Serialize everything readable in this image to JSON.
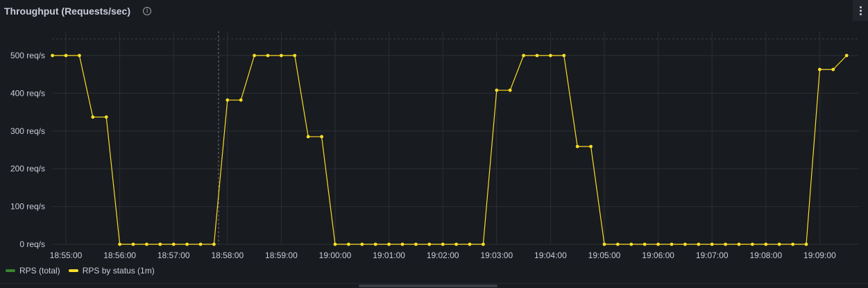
{
  "panel": {
    "title": "Throughput (Requests/sec)",
    "info_icon": "info-icon",
    "menu_icon": "kebab-menu-icon"
  },
  "chart_data": {
    "type": "line",
    "title": "Throughput (Requests/sec)",
    "xlabel": "",
    "ylabel": "",
    "ylim": [
      0,
      500
    ],
    "yticks": [
      "0 req/s",
      "100 req/s",
      "200 req/s",
      "300 req/s",
      "400 req/s",
      "500 req/s"
    ],
    "xticks": [
      "18:55:00",
      "18:56:00",
      "18:57:00",
      "18:58:00",
      "18:59:00",
      "19:00:00",
      "19:01:00",
      "19:02:00",
      "19:03:00",
      "19:04:00",
      "19:05:00",
      "19:06:00",
      "19:07:00",
      "19:08:00",
      "19:09:00"
    ],
    "grid": true,
    "legend_position": "bottom-left",
    "colors": {
      "rps_total": "#37872d",
      "rps_status": "#fade2a",
      "grid": "#2c2f35",
      "axis_text": "#ccccdc"
    },
    "series": [
      {
        "name": "RPS (total)",
        "values": []
      },
      {
        "name": "RPS by status (1m)",
        "x": [
          "18:54:45",
          "18:55:00",
          "18:55:15",
          "18:55:30",
          "18:55:45",
          "18:56:00",
          "18:56:15",
          "18:56:30",
          "18:56:45",
          "18:57:00",
          "18:57:15",
          "18:57:30",
          "18:57:45",
          "18:58:00",
          "18:58:15",
          "18:58:30",
          "18:58:45",
          "18:59:00",
          "18:59:15",
          "18:59:30",
          "18:59:45",
          "19:00:00",
          "19:00:15",
          "19:00:30",
          "19:00:45",
          "19:01:00",
          "19:01:15",
          "19:01:30",
          "19:01:45",
          "19:02:00",
          "19:02:15",
          "19:02:30",
          "19:02:45",
          "19:03:00",
          "19:03:15",
          "19:03:30",
          "19:03:45",
          "19:04:00",
          "19:04:15",
          "19:04:30",
          "19:04:45",
          "19:05:00",
          "19:05:15",
          "19:05:30",
          "19:05:45",
          "19:06:00",
          "19:06:15",
          "19:06:30",
          "19:06:45",
          "19:07:00",
          "19:07:15",
          "19:07:30",
          "19:07:45",
          "19:08:00",
          "19:08:15",
          "19:08:30",
          "19:08:45",
          "19:09:00",
          "19:09:15",
          "19:09:30"
        ],
        "values": [
          500,
          500,
          500,
          337,
          337,
          0,
          0,
          0,
          0,
          0,
          0,
          0,
          0,
          382,
          382,
          500,
          500,
          500,
          500,
          285,
          285,
          0,
          0,
          0,
          0,
          0,
          0,
          0,
          0,
          0,
          0,
          0,
          0,
          408,
          408,
          500,
          500,
          500,
          500,
          259,
          259,
          0,
          0,
          0,
          0,
          0,
          0,
          0,
          0,
          0,
          0,
          0,
          0,
          0,
          0,
          0,
          0,
          463,
          463,
          500
        ]
      }
    ]
  },
  "legend": {
    "items": [
      {
        "label": "RPS (total)",
        "color": "#37872d"
      },
      {
        "label": "RPS by status (1m)",
        "color": "#fade2a"
      }
    ]
  }
}
